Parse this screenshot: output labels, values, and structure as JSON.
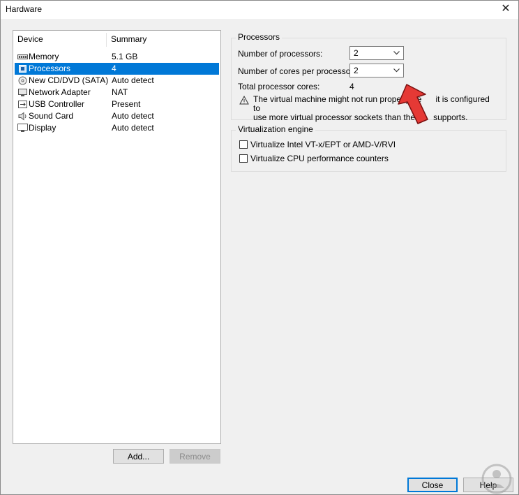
{
  "window": {
    "title": "Hardware",
    "close_glyph": "✕"
  },
  "device_list": {
    "columns": {
      "device": "Device",
      "summary": "Summary"
    },
    "items": [
      {
        "name": "Memory",
        "summary": "5.1 GB",
        "icon": "memory-icon",
        "selected": false
      },
      {
        "name": "Processors",
        "summary": "4",
        "icon": "processor-icon",
        "selected": true
      },
      {
        "name": "New CD/DVD (SATA)",
        "summary": "Auto detect",
        "icon": "cd-dvd-icon",
        "selected": false
      },
      {
        "name": "Network Adapter",
        "summary": "NAT",
        "icon": "network-adapter-icon",
        "selected": false
      },
      {
        "name": "USB Controller",
        "summary": "Present",
        "icon": "usb-icon",
        "selected": false
      },
      {
        "name": "Sound Card",
        "summary": "Auto detect",
        "icon": "speaker-icon",
        "selected": false
      },
      {
        "name": "Display",
        "summary": "Auto detect",
        "icon": "monitor-icon",
        "selected": false
      }
    ],
    "add_label": "Add...",
    "remove_label": "Remove"
  },
  "processors": {
    "group_label": "Processors",
    "num_processors_label": "Number of processors:",
    "num_processors_value": "2",
    "cores_per_processor_label": "Number of cores per processor:",
    "cores_per_processor_value": "2",
    "total_cores_label": "Total processor cores:",
    "total_cores_value": "4",
    "warning_line1": "The virtual machine might not run properly be",
    "warning_line1_tail": "it is configured to",
    "warning_line2": "use more virtual processor sockets than the",
    "warning_line2_tail": "supports."
  },
  "virtualization": {
    "group_label": "Virtualization engine",
    "options": [
      {
        "label": "Virtualize Intel VT-x/EPT or AMD-V/RVI",
        "checked": false
      },
      {
        "label": "Virtualize CPU performance counters",
        "checked": false
      }
    ]
  },
  "footer": {
    "close_label": "Close",
    "help_label": "Help"
  },
  "colors": {
    "selection": "#0078d7",
    "arrow": "#e53935",
    "watermark": "#9e9e9e"
  }
}
